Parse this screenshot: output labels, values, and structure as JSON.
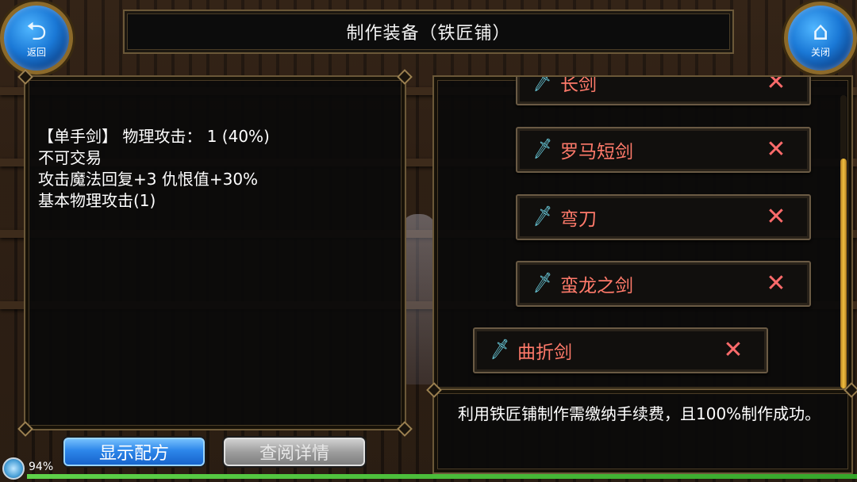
{
  "header": {
    "title": "制作装备（铁匠铺）",
    "back_label": "返回",
    "back_icon": "back-arrow-icon",
    "close_label": "关闭",
    "close_icon": "home-icon"
  },
  "item_description": {
    "line1": "【单手剑】 物理攻击： 1 (40%)",
    "line2": "不可交易",
    "line3": "攻击魔法回复+3 仇恨值+30%",
    "line4": "基本物理攻击(1)"
  },
  "recipes": [
    {
      "name": "长剑",
      "icon": "sword-icon",
      "action_icon": "close-x-icon"
    },
    {
      "name": "罗马短剑",
      "icon": "sword-icon",
      "action_icon": "close-x-icon"
    },
    {
      "name": "弯刀",
      "icon": "sword-icon",
      "action_icon": "close-x-icon"
    },
    {
      "name": "蛮龙之剑",
      "icon": "sword-icon",
      "action_icon": "close-x-icon"
    },
    {
      "name": "曲折剑",
      "icon": "sword-icon",
      "action_icon": "close-x-icon"
    }
  ],
  "info": {
    "text": "利用铁匠铺制作需缴纳手续费，且100%制作成功。"
  },
  "buttons": {
    "show_recipe": "显示配方",
    "view_details": "查阅详情"
  },
  "status": {
    "battery": "94%"
  },
  "colors": {
    "recipe_name": "#ff7a6a",
    "primary_button": "#2d86ea",
    "disabled_button": "#9e9e9e",
    "frame_gold": "#6b5838"
  }
}
